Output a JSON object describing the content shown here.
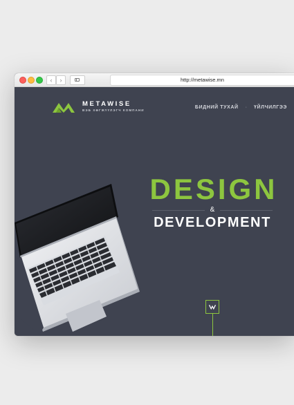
{
  "browser": {
    "url": "http://metawise.mn"
  },
  "brand": {
    "name": "METAWISE",
    "tagline": "ВЭБ ХӨГЖҮҮЛЭГЧ КОМПАНИ",
    "accent_color": "#8dc63f",
    "background_color": "#3f4350"
  },
  "nav": {
    "items": [
      {
        "label": "БИДНИЙ ТУХАЙ"
      },
      {
        "label": "ҮЙЛЧИЛГЭЭ"
      }
    ],
    "separator": "·"
  },
  "hero": {
    "line1": "DESIGN",
    "amp": "&",
    "line2": "DEVELOPMENT"
  },
  "scroll_button": {
    "glyph": "W",
    "icon": "scroll-down-logo-icon"
  }
}
